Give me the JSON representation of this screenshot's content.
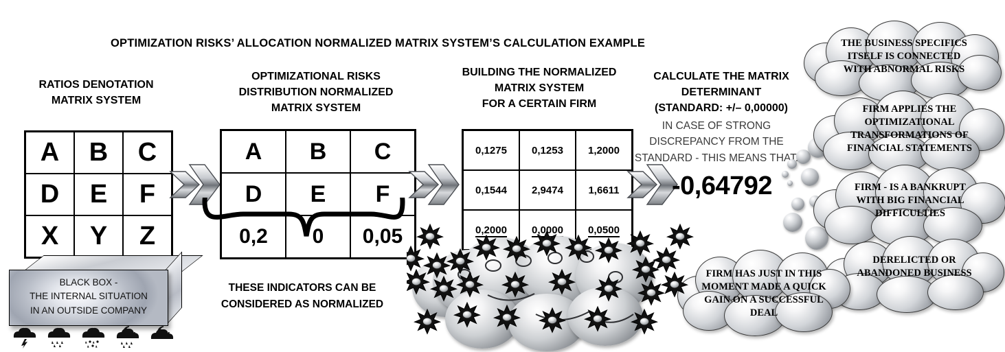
{
  "title": "OPTIMIZATION RISKS’ ALLOCATION NORMALIZED MATRIX SYSTEM’S CALCULATION EXAMPLE",
  "columns": {
    "col1_heading": "RATIOS DENOTATION\nMATRIX SYSTEM",
    "col2_heading": "OPTIMIZATIONAL RISKS\nDISTRIBUTION NORMALIZED\nMATRIX SYSTEM",
    "col3_heading": "BUILDING THE NORMALIZED\nMATRIX SYSTEM\nFOR A CERTAIN FIRM",
    "col4_heading": "CALCULATE THE MATRIX\nDETERMINANT\n(STANDARD: +/– 0,00000)"
  },
  "matrix1": {
    "name": "ratios-denotation-matrix",
    "rows": [
      [
        "A",
        "B",
        "C"
      ],
      [
        "D",
        "E",
        "F"
      ],
      [
        "X",
        "Y",
        "Z"
      ]
    ]
  },
  "matrix2": {
    "name": "optimizational-risks-distribution-matrix",
    "rows": [
      [
        "A",
        "B",
        "C"
      ],
      [
        "D",
        "E",
        "F"
      ],
      [
        "0,2",
        "0",
        "0,05"
      ]
    ]
  },
  "matrix3": {
    "name": "normalized-matrix-for-firm",
    "rows": [
      [
        "0,1275",
        "0,1253",
        "1,2000"
      ],
      [
        "0,1544",
        "2,9474",
        "1,6611"
      ],
      [
        "0,2000",
        "0,0000",
        "0,0500"
      ]
    ]
  },
  "determinant": {
    "note": "IN CASE OF STRONG\nDISCREPANCY FROM THE\nSTANDARD - THIS MEANS THAT:",
    "value": "-0,64792"
  },
  "brace_caption": "THESE INDICATORS CAN BE\nCONSIDERED AS NORMALIZED",
  "black_box": {
    "label": "BLACK BOX -\nTHE INTERNAL SITUATION\nIN AN OUTSIDE COMPANY",
    "weather_icons": [
      "thunderstorm-icon",
      "rain-icon",
      "sleet-icon",
      "rain-moon-icon",
      "cloudy-moon-icon"
    ]
  },
  "clouds": [
    {
      "id": "cloud-abnormal-risks",
      "text": "THE BUSINESS  SPECIFICS\nITSELF IS CONNECTED\nWITH ABNORMAL RISKS"
    },
    {
      "id": "cloud-optimizational-transformations",
      "text": "FIRM APPLIES THE\nOPTIMIZATIONAL\nTRANSFORMATIONS OF\nFINANCIAL STATEMENTS"
    },
    {
      "id": "cloud-bankrupt",
      "text": "FIRM - IS A BANKRUPT\nWITH BIG FINANCIAL\nDIFFICULTIES"
    },
    {
      "id": "cloud-derelicted-business",
      "text": "DERELICTED  OR\nABANDONED BUSINESS"
    },
    {
      "id": "cloud-quick-gain",
      "text": "FIRM HAS JUST  IN THIS\nMOMENT MADE A QUICK\nGAIN ON A SUCCESSFUL\nDEAL"
    }
  ],
  "arrows": [
    "arrow-1",
    "arrow-2",
    "arrow-3"
  ],
  "colors": {
    "ink": "#000000",
    "metal_light": "#ffffff",
    "metal_mid": "#c9ccd2",
    "metal_dark": "#8e9297",
    "subtext": "#3a3a3a"
  }
}
